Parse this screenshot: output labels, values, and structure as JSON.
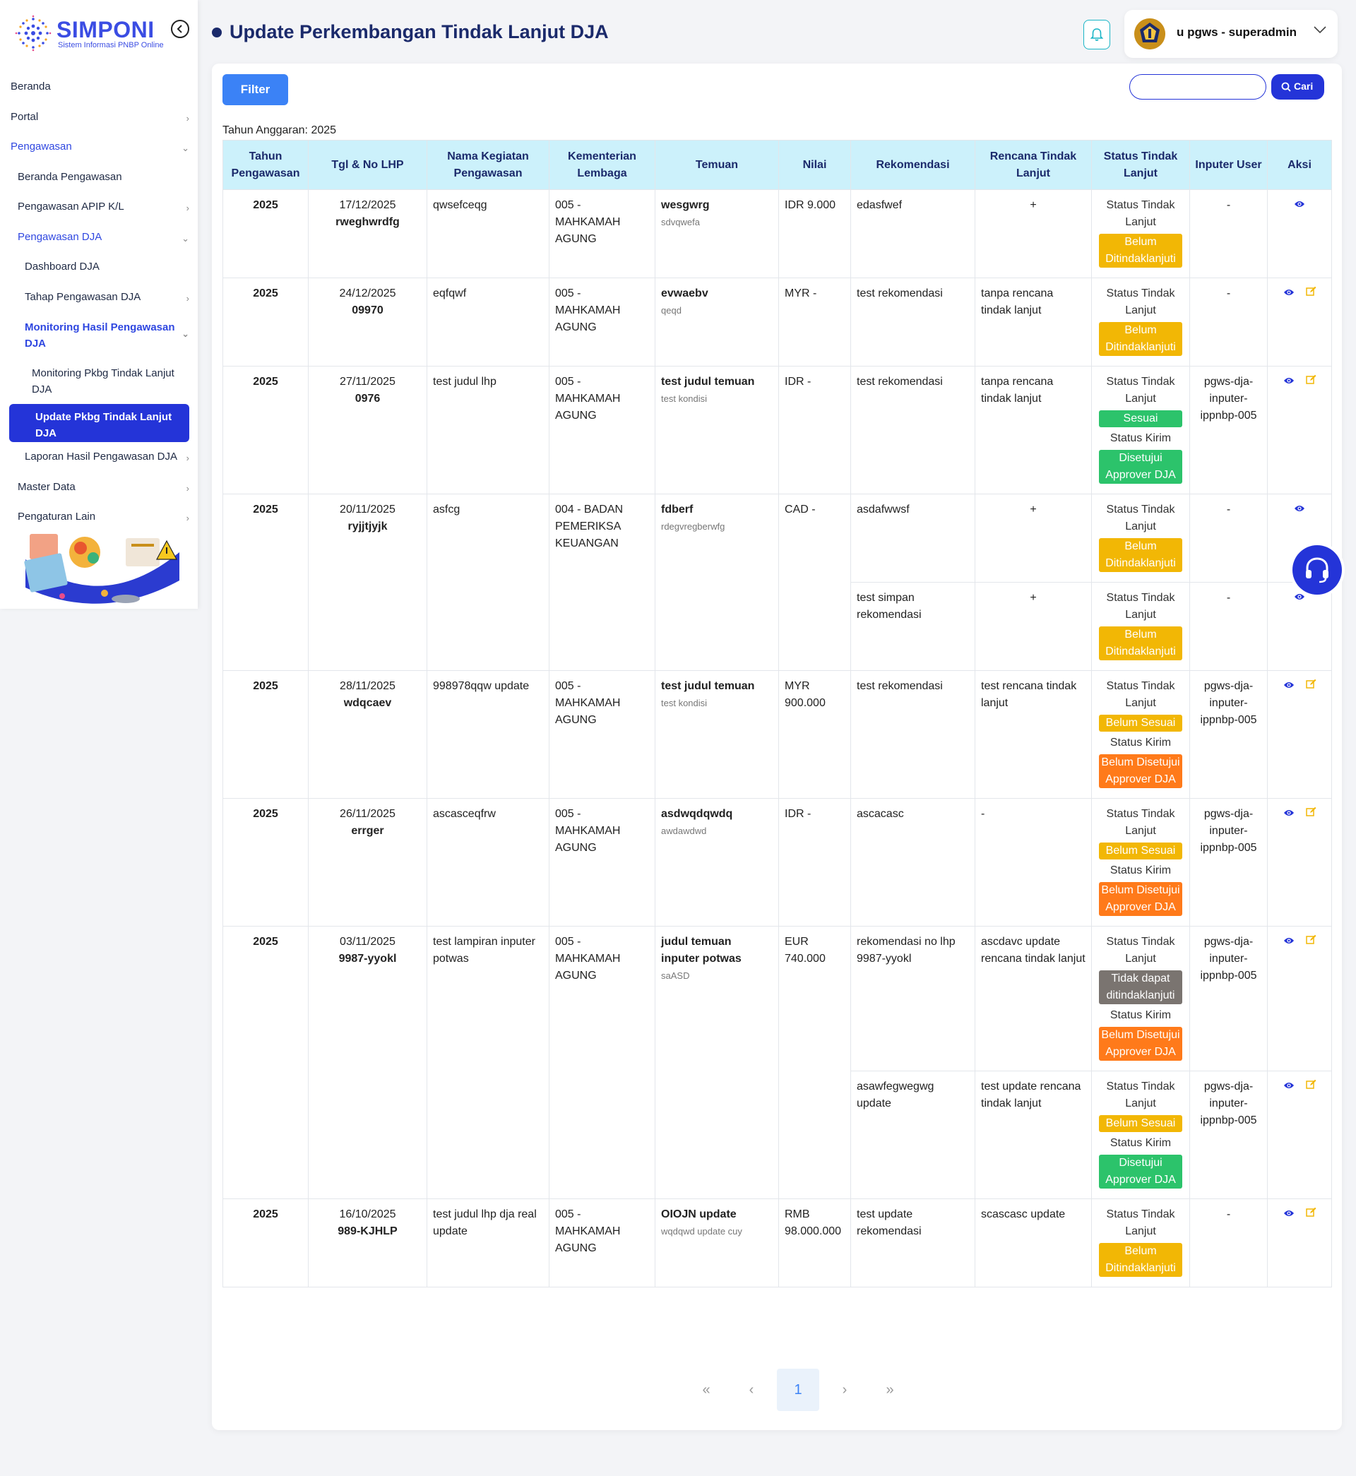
{
  "brand": {
    "name": "SIMPONI",
    "subtitle": "Sistem Informasi PNBP Online"
  },
  "sidebar": {
    "items": [
      {
        "label": "Beranda"
      },
      {
        "label": "Portal"
      },
      {
        "label": "Pengawasan"
      },
      {
        "label": "Beranda Pengawasan"
      },
      {
        "label": "Pengawasan APIP K/L"
      },
      {
        "label": "Pengawasan DJA"
      },
      {
        "label": "Dashboard DJA"
      },
      {
        "label": "Tahap Pengawasan DJA"
      },
      {
        "label": "Monitoring Hasil Pengawasan DJA"
      },
      {
        "label": "Monitoring Pkbg Tindak Lanjut DJA"
      },
      {
        "label": "Update Pkbg Tindak Lanjut DJA"
      },
      {
        "label": "Laporan Hasil Pengawasan DJA"
      },
      {
        "label": "Master Data"
      },
      {
        "label": "Pengaturan Lain"
      }
    ]
  },
  "header": {
    "title": "Update Perkembangan Tindak Lanjut DJA",
    "user": "u pgws - superadmin"
  },
  "toolbar": {
    "filter_label": "Filter",
    "search_placeholder": "",
    "search_label": "Cari",
    "year_label": "Tahun Anggaran: 2025"
  },
  "table": {
    "columns": [
      "Tahun Pengawasan",
      "Tgl & No LHP",
      "Nama Kegiatan Pengawasan",
      "Kementerian Lembaga",
      "Temuan",
      "Nilai",
      "Rekomendasi",
      "Rencana Tindak Lanjut",
      "Status Tindak Lanjut",
      "Inputer User",
      "Aksi"
    ],
    "status_label": "Status Tindak Lanjut",
    "kirim_label": "Status Kirim",
    "rows": [
      {
        "tahun": "2025",
        "tgl": "17/12/2025",
        "no": "rweghwrdfg",
        "kegiatan": "qwsefceqg",
        "kl": "005 - MAHKAMAH AGUNG",
        "temuan": "wesgwrg",
        "kondisi": "sdvqwefa",
        "nilai": "IDR 9.000",
        "recs": [
          {
            "rek": "edasfwef",
            "rtl": "+",
            "status": "Belum Ditindaklanjuti",
            "inputer": "-"
          }
        ]
      },
      {
        "tahun": "2025",
        "tgl": "24/12/2025",
        "no": "09970",
        "kegiatan": "eqfqwf",
        "kl": "005 - MAHKAMAH AGUNG",
        "temuan": "evwaebv",
        "kondisi": "qeqd",
        "nilai": "MYR -",
        "recs": [
          {
            "rek": "test rekomendasi",
            "rtl": "tanpa rencana tindak lanjut",
            "status": "Belum Ditindaklanjuti",
            "inputer": "-"
          }
        ]
      },
      {
        "tahun": "2025",
        "tgl": "27/11/2025",
        "no": "0976",
        "kegiatan": "test judul lhp",
        "kl": "005 - MAHKAMAH AGUNG",
        "temuan": "test judul temuan",
        "kondisi": "test kondisi",
        "nilai": "IDR -",
        "recs": [
          {
            "rek": "test rekomendasi",
            "rtl": "tanpa rencana tindak lanjut",
            "status": "Sesuai",
            "kirim": "Disetujui Approver DJA",
            "inputer": "pgws-dja-inputer-ippnbp-005"
          }
        ]
      },
      {
        "tahun": "2025",
        "tgl": "20/11/2025",
        "no": "ryjjtjyjk",
        "kegiatan": "asfcg",
        "kl": "004 - BADAN PEMERIKSA KEUANGAN",
        "temuan": "fdberf",
        "kondisi": "rdegvregberwfg",
        "nilai": "CAD -",
        "recs": [
          {
            "rek": "asdafwwsf",
            "rtl": "+",
            "status": "Belum Ditindaklanjuti",
            "inputer": "-"
          },
          {
            "rek": "test simpan rekomendasi",
            "rtl": "+",
            "status": "Belum Ditindaklanjuti",
            "inputer": "-"
          }
        ]
      },
      {
        "tahun": "2025",
        "tgl": "28/11/2025",
        "no": "wdqcaev",
        "kegiatan": "998978qqw update",
        "kl": "005 - MAHKAMAH AGUNG",
        "temuan": "test judul temuan",
        "kondisi": "test kondisi",
        "nilai": "MYR 900.000",
        "recs": [
          {
            "rek": "test rekomendasi",
            "rtl": "test rencana tindak lanjut",
            "status": "Belum Sesuai",
            "kirim": "Belum Disetujui Approver DJA",
            "inputer": "pgws-dja-inputer-ippnbp-005"
          }
        ]
      },
      {
        "tahun": "2025",
        "tgl": "26/11/2025",
        "no": "errger",
        "kegiatan": "ascasceqfrw",
        "kl": "005 - MAHKAMAH AGUNG",
        "temuan": "asdwqdqwdq",
        "kondisi": "awdawdwd",
        "nilai": "IDR -",
        "recs": [
          {
            "rek": "ascacasc",
            "rtl": "-",
            "status": "Belum Sesuai",
            "kirim": "Belum Disetujui Approver DJA",
            "inputer": "pgws-dja-inputer-ippnbp-005"
          }
        ]
      },
      {
        "tahun": "2025",
        "tgl": "03/11/2025",
        "no": "9987-yyokl",
        "kegiatan": "test lampiran inputer potwas",
        "kl": "005 - MAHKAMAH AGUNG",
        "temuan": "judul temuan inputer potwas",
        "kondisi": "saASD",
        "nilai": "EUR 740.000",
        "recs": [
          {
            "rek": "rekomendasi no lhp 9987-yyokl",
            "rtl": "ascdavc update rencana tindak lanjut",
            "status": "Tidak dapat ditindaklanjuti",
            "kirim": "Belum Disetujui Approver DJA",
            "inputer": "pgws-dja-inputer-ippnbp-005"
          },
          {
            "rek": "asawfegwegwg update",
            "rtl": "test update rencana tindak lanjut",
            "status": "Belum Sesuai",
            "kirim": "Disetujui Approver DJA",
            "inputer": "pgws-dja-inputer-ippnbp-005"
          }
        ]
      },
      {
        "tahun": "2025",
        "tgl": "16/10/2025",
        "no": "989-KJHLP",
        "kegiatan": "test judul lhp dja real update",
        "kl": "005 - MAHKAMAH AGUNG",
        "temuan": "OIOJN update",
        "kondisi": "wqdqwd update cuy",
        "nilai": "RMB 98.000.000",
        "recs": [
          {
            "rek": "test update rekomendasi",
            "rtl": "scascasc update",
            "status": "Belum Ditindaklanjuti",
            "inputer": "-"
          }
        ]
      }
    ]
  },
  "pagination": {
    "first": "«",
    "prev": "‹",
    "current": "1",
    "next": "›",
    "last": "»"
  },
  "colors": {
    "primary": "#2434d8",
    "accent": "#3b82f6",
    "header_bg": "#ccf1fb",
    "yellow": "#f2b705",
    "green": "#2cc36b",
    "orange": "#ff7a1a",
    "gray": "#7a7470"
  }
}
